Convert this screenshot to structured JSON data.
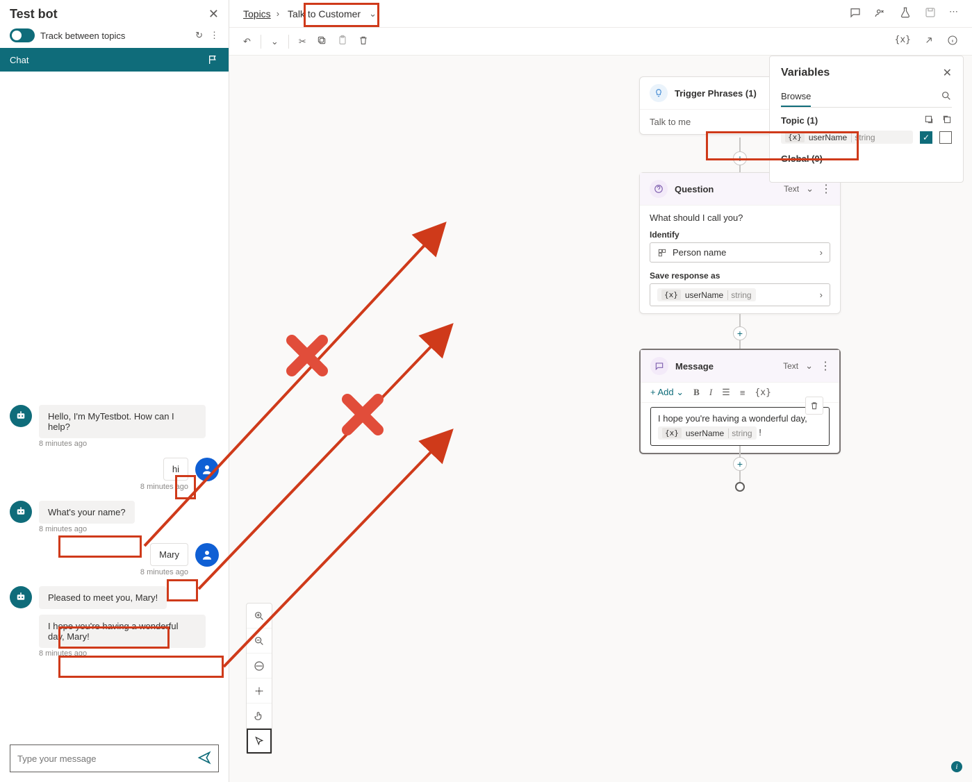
{
  "testbot": {
    "title": "Test bot",
    "track_label": "Track between topics",
    "chat_tab": "Chat",
    "input_placeholder": "Type your message",
    "messages": [
      {
        "from": "bot",
        "text": "Hello, I'm MyTestbot. How can I help?",
        "time": "8 minutes ago"
      },
      {
        "from": "user",
        "text": "hi",
        "time": "8 minutes ago"
      },
      {
        "from": "bot",
        "text": "What's your name?",
        "time": "8 minutes ago"
      },
      {
        "from": "user",
        "text": "Mary",
        "time": "8 minutes ago"
      },
      {
        "from": "bot",
        "text": "Pleased to meet you, Mary!",
        "time": ""
      },
      {
        "from": "bot",
        "text": "I hope you're having a wonderful day, Mary!",
        "time": "8 minutes ago"
      }
    ]
  },
  "breadcrumb": {
    "root": "Topics",
    "current": "Talk to Customer"
  },
  "nodes": {
    "trigger": {
      "title": "Trigger Phrases (1)",
      "phrase": "Talk to me"
    },
    "question": {
      "title": "Question",
      "type_label": "Text",
      "prompt": "What should I call you?",
      "identify_label": "Identify",
      "identify_value": "Person name",
      "save_label": "Save response as",
      "var_name": "userName",
      "var_type": "string"
    },
    "message": {
      "title": "Message",
      "type_label": "Text",
      "add_label": "Add",
      "text": "I hope you're having a wonderful day,",
      "var_name": "userName",
      "var_type": "string",
      "punct": "!"
    }
  },
  "variables": {
    "panel_title": "Variables",
    "browse_tab": "Browse",
    "topic_header": "Topic (1)",
    "global_header": "Global (0)",
    "var_name": "userName",
    "var_type": "string"
  }
}
